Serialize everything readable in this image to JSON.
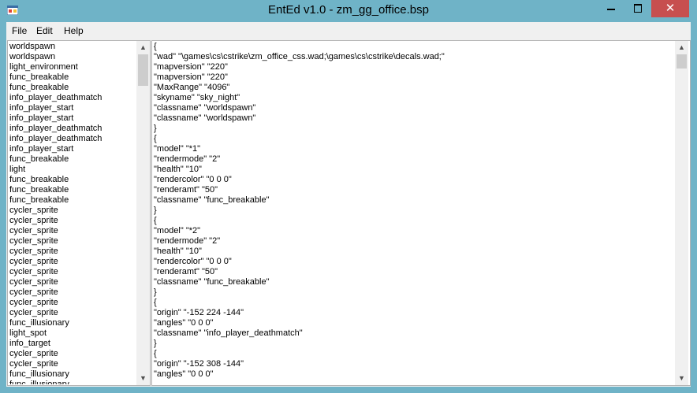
{
  "window": {
    "title": "EntEd v1.0 - zm_gg_office.bsp",
    "close_glyph": "✕"
  },
  "menu": [
    {
      "label": "File"
    },
    {
      "label": "Edit"
    },
    {
      "label": "Help"
    }
  ],
  "entity_list": [
    "worldspawn",
    "worldspawn",
    "light_environment",
    "func_breakable",
    "func_breakable",
    "info_player_deathmatch",
    "info_player_start",
    "info_player_start",
    "info_player_deathmatch",
    "info_player_deathmatch",
    "info_player_start",
    "func_breakable",
    "light",
    "func_breakable",
    "func_breakable",
    "func_breakable",
    "cycler_sprite",
    "cycler_sprite",
    "cycler_sprite",
    "cycler_sprite",
    "cycler_sprite",
    "cycler_sprite",
    "cycler_sprite",
    "cycler_sprite",
    "cycler_sprite",
    "cycler_sprite",
    "cycler_sprite",
    "func_illusionary",
    "light_spot",
    "info_target",
    "cycler_sprite",
    "cycler_sprite",
    "func_illusionary",
    "func_illusionary"
  ],
  "editor_lines": [
    "{",
    "\"wad\" \"\\games\\cs\\cstrike\\zm_office_css.wad;\\games\\cs\\cstrike\\decals.wad;\"",
    "\"mapversion\" \"220\"",
    "\"mapversion\" \"220\"",
    "\"MaxRange\" \"4096\"",
    "\"skyname\" \"sky_night\"",
    "\"classname\" \"worldspawn\"",
    "\"classname\" \"worldspawn\"",
    "}",
    "{",
    "\"model\" \"*1\"",
    "\"rendermode\" \"2\"",
    "\"health\" \"10\"",
    "\"rendercolor\" \"0 0 0\"",
    "\"renderamt\" \"50\"",
    "\"classname\" \"func_breakable\"",
    "}",
    "{",
    "\"model\" \"*2\"",
    "\"rendermode\" \"2\"",
    "\"health\" \"10\"",
    "\"rendercolor\" \"0 0 0\"",
    "\"renderamt\" \"50\"",
    "\"classname\" \"func_breakable\"",
    "}",
    "{",
    "\"origin\" \"-152 224 -144\"",
    "\"angles\" \"0 0 0\"",
    "\"classname\" \"info_player_deathmatch\"",
    "}",
    "{",
    "\"origin\" \"-152 308 -144\"",
    "\"angles\" \"0 0 0\""
  ],
  "colors": {
    "frame": "#6fb3c7",
    "close_button": "#c74f4f",
    "chrome": "#f0f0f0"
  }
}
